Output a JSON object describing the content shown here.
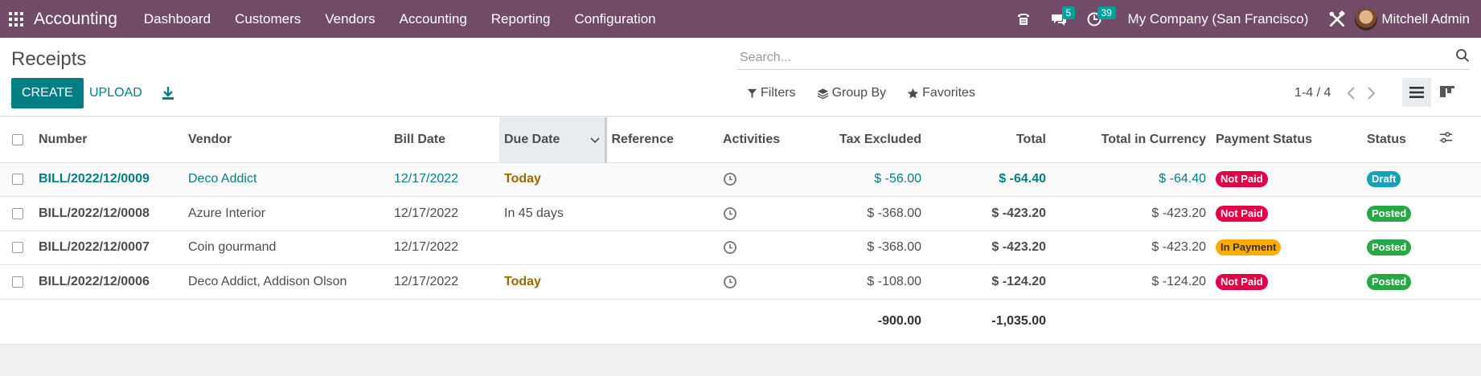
{
  "navbar": {
    "brand": "Accounting",
    "menu": [
      "Dashboard",
      "Customers",
      "Vendors",
      "Accounting",
      "Reporting",
      "Configuration"
    ],
    "messages_count": "5",
    "activities_count": "39",
    "company": "My Company (San Francisco)",
    "user": "Mitchell Admin"
  },
  "control": {
    "title": "Receipts",
    "search_placeholder": "Search...",
    "create_label": "CREATE",
    "upload_label": "UPLOAD",
    "filters_label": "Filters",
    "groupby_label": "Group By",
    "favorites_label": "Favorites",
    "pager": "1-4 / 4"
  },
  "table": {
    "columns": [
      "Number",
      "Vendor",
      "Bill Date",
      "Due Date",
      "Reference",
      "Activities",
      "Tax Excluded",
      "Total",
      "Total in Currency",
      "Payment Status",
      "Status"
    ],
    "rows": [
      {
        "number": "BILL/2022/12/0009",
        "vendor": "Deco Addict",
        "bill_date": "12/17/2022",
        "due_date": "Today",
        "reference": "",
        "tax_excluded": "$ -56.00",
        "total": "$ -64.40",
        "total_currency": "$ -64.40",
        "payment_status": "Not Paid",
        "status": "Draft"
      },
      {
        "number": "BILL/2022/12/0008",
        "vendor": "Azure Interior",
        "bill_date": "12/17/2022",
        "due_date": "In 45 days",
        "reference": "",
        "tax_excluded": "$ -368.00",
        "total": "$ -423.20",
        "total_currency": "$ -423.20",
        "payment_status": "Not Paid",
        "status": "Posted"
      },
      {
        "number": "BILL/2022/12/0007",
        "vendor": "Coin gourmand",
        "bill_date": "12/17/2022",
        "due_date": "",
        "reference": "",
        "tax_excluded": "$ -368.00",
        "total": "$ -423.20",
        "total_currency": "$ -423.20",
        "payment_status": "In Payment",
        "status": "Posted"
      },
      {
        "number": "BILL/2022/12/0006",
        "vendor": "Deco Addict, Addison Olson",
        "bill_date": "12/17/2022",
        "due_date": "Today",
        "reference": "",
        "tax_excluded": "$ -108.00",
        "total": "$ -124.20",
        "total_currency": "$ -124.20",
        "payment_status": "Not Paid",
        "status": "Posted"
      }
    ],
    "totals": {
      "tax_excluded": "-900.00",
      "total": "-1,035.00"
    }
  },
  "colors": {
    "navbar": "#714b67",
    "primary": "#017e84",
    "not_paid": "#e40047",
    "in_payment": "#ffac00",
    "posted": "#28a745",
    "draft": "#17a2b8"
  }
}
